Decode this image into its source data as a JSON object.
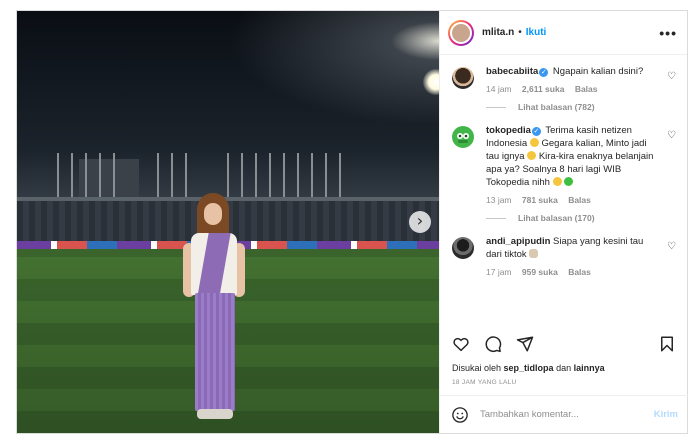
{
  "post": {
    "username": "mlita.n",
    "separator": "•",
    "follow_label": "Ikuti",
    "more_label": "•••",
    "next_label": "›"
  },
  "comments": [
    {
      "username": "babecabiita",
      "verified": true,
      "text": "Ngapain kalian dsini?",
      "time": "14 jam",
      "likes": "2,611 suka",
      "reply_label": "Balas",
      "view_replies": "Lihat balasan (782)"
    },
    {
      "username": "tokopedia",
      "verified": true,
      "text_1": "Terima kasih netizen Indonesia",
      "text_2": "Gegara kalian, Minto jadi tau ignya",
      "text_3": "Kira-kira enaknya belanjain apa ya? Soalnya 8 hari lagi WIB Tokopedia nihh",
      "time": "13 jam",
      "likes": "781 suka",
      "reply_label": "Balas",
      "view_replies": "Lihat balasan (170)"
    },
    {
      "username": "andi_apipudin",
      "verified": false,
      "text": "Siapa yang kesini tau dari tiktok",
      "time": "17 jam",
      "likes": "959 suka",
      "reply_label": "Balas"
    }
  ],
  "liked_by": {
    "prefix": "Disukai oleh",
    "user": "sep_tidlopa",
    "conj": "dan",
    "others": "lainnya"
  },
  "timestamp": "18 JAM YANG LALU",
  "composer": {
    "placeholder": "Tambahkan komentar...",
    "send_label": "Kirim"
  },
  "colors": {
    "accent": "#0095f6",
    "send_disabled": "#b3dbff",
    "verified": "#3897f0",
    "muted": "#8e8e8e"
  },
  "icons": [
    "heart-icon",
    "comment-icon",
    "share-icon",
    "bookmark-icon",
    "emoji-icon",
    "chevron-right-icon",
    "verified-icon",
    "more-icon"
  ]
}
